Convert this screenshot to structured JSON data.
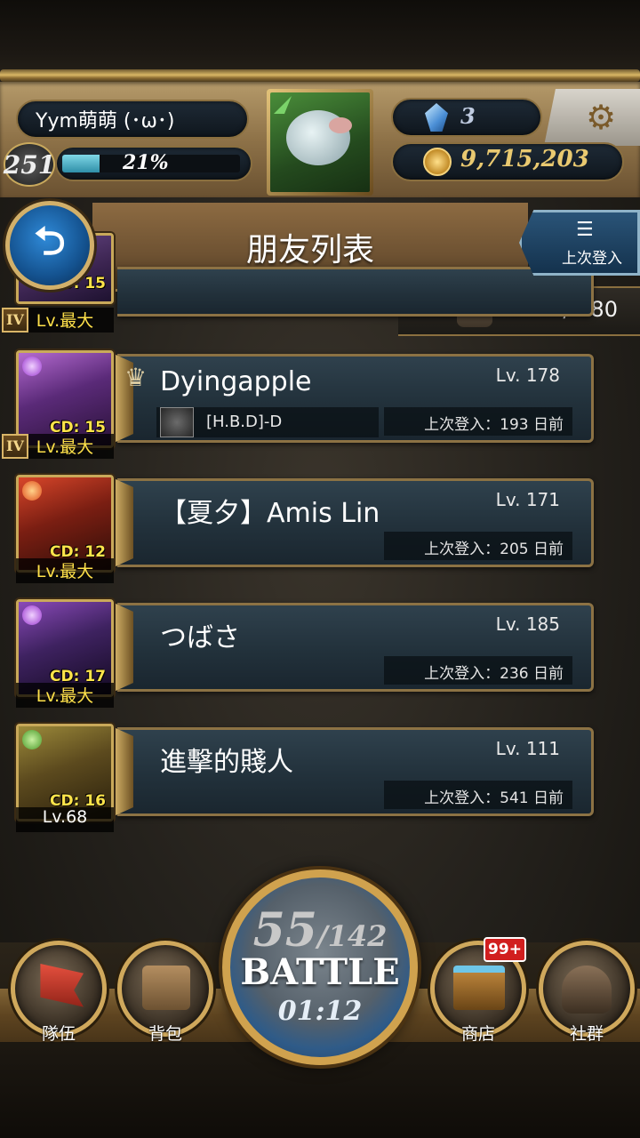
{
  "header": {
    "player_name": "Yym萌萌 (･ω･)",
    "player_level": "251",
    "exp_percent_label": "21%",
    "exp_fraction": 0.21,
    "gems": "3",
    "coins": "9,715,203"
  },
  "title_bar": {
    "title": "朋友列表",
    "back_icon": "back-arrow-icon",
    "back_glyph": "⮌",
    "sort_icon_glyph": "☰",
    "sort_label": "上次登入"
  },
  "friend_count": "244 / 280",
  "partial_card": {
    "cd": "CD: 15",
    "level": "Lv.最大",
    "rank": "IV"
  },
  "friends": [
    {
      "name": "Dyingapple",
      "level": "Lv. 178",
      "guild": "[H.B.D]-D",
      "last_login": "上次登入：193 日前",
      "card_cd": "CD: 15",
      "card_level": "Lv.最大",
      "rank": "IV"
    },
    {
      "name": "【夏夕】Amis Lin",
      "level": "Lv. 171",
      "last_login": "上次登入：205 日前",
      "card_cd": "CD: 12",
      "card_level": "Lv.最大"
    },
    {
      "name": "つばさ",
      "level": "Lv. 185",
      "last_login": "上次登入：236 日前",
      "card_cd": "CD: 17",
      "card_level": "Lv.最大"
    },
    {
      "name": "進擊的賤人",
      "level": "Lv. 111",
      "last_login": "上次登入：541 日前",
      "card_cd": "CD: 16",
      "card_level": "Lv.68"
    }
  ],
  "battle": {
    "stamina_current": "55",
    "stamina_max": "/142",
    "label": "BATTLE",
    "timer": "01:12"
  },
  "nav": {
    "team": "隊伍",
    "bag": "背包",
    "shop": "商店",
    "shop_badge": "99+",
    "social": "社群"
  },
  "colors": {
    "gold_frame": "#c9a95a",
    "cd_yellow": "#ffe44a",
    "exp_fill": "#2f8fa8",
    "badge_red": "#d11e1e"
  }
}
